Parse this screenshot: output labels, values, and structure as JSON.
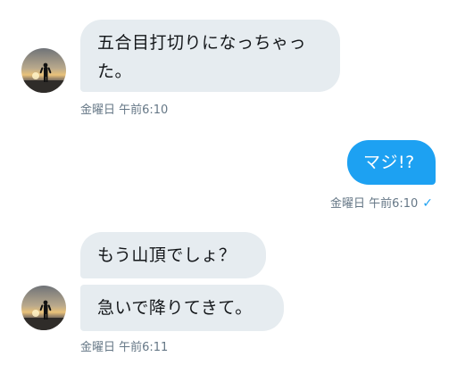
{
  "messages": [
    {
      "direction": "incoming",
      "text": "五合目打切りになっちゃった。",
      "line1": "五合目打切りになっちゃっ",
      "line2": "た。"
    },
    {
      "direction": "outgoing",
      "text": "マジ!?"
    },
    {
      "direction": "incoming",
      "text": "もう山頂でしょ？"
    },
    {
      "direction": "incoming",
      "text": "急いで降りてきて。"
    }
  ],
  "timestamps": {
    "first_incoming": "金曜日 午前6:10",
    "outgoing": "金曜日 午前6:10",
    "last_incoming": "金曜日 午前6:11"
  },
  "read_receipt_icon": "checkmark-icon",
  "colors": {
    "incoming_bubble": "#e6ecf0",
    "outgoing_bubble": "#1da1f2",
    "timestamp": "#657786",
    "checkmark": "#1da1f2"
  }
}
